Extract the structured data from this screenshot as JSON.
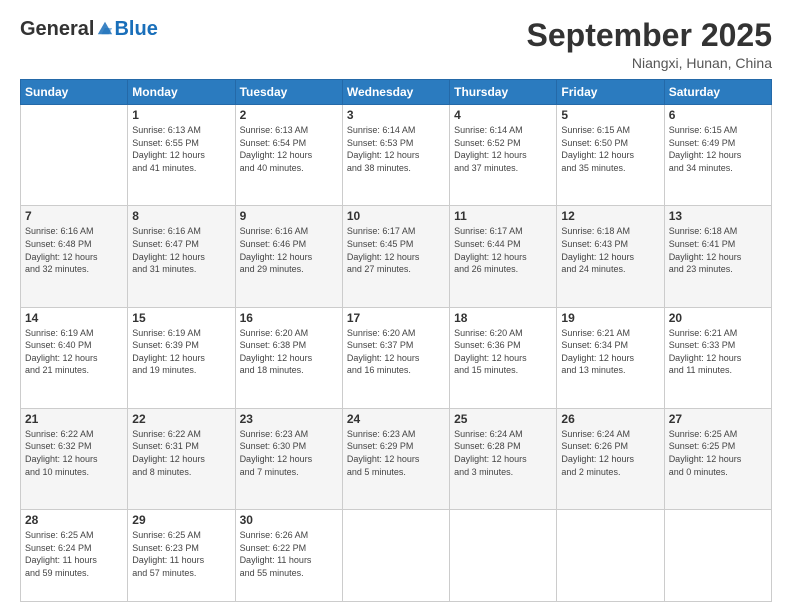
{
  "logo": {
    "general": "General",
    "blue": "Blue"
  },
  "header": {
    "month": "September 2025",
    "location": "Niangxi, Hunan, China"
  },
  "days_of_week": [
    "Sunday",
    "Monday",
    "Tuesday",
    "Wednesday",
    "Thursday",
    "Friday",
    "Saturday"
  ],
  "weeks": [
    [
      {
        "day": "",
        "info": ""
      },
      {
        "day": "1",
        "info": "Sunrise: 6:13 AM\nSunset: 6:55 PM\nDaylight: 12 hours\nand 41 minutes."
      },
      {
        "day": "2",
        "info": "Sunrise: 6:13 AM\nSunset: 6:54 PM\nDaylight: 12 hours\nand 40 minutes."
      },
      {
        "day": "3",
        "info": "Sunrise: 6:14 AM\nSunset: 6:53 PM\nDaylight: 12 hours\nand 38 minutes."
      },
      {
        "day": "4",
        "info": "Sunrise: 6:14 AM\nSunset: 6:52 PM\nDaylight: 12 hours\nand 37 minutes."
      },
      {
        "day": "5",
        "info": "Sunrise: 6:15 AM\nSunset: 6:50 PM\nDaylight: 12 hours\nand 35 minutes."
      },
      {
        "day": "6",
        "info": "Sunrise: 6:15 AM\nSunset: 6:49 PM\nDaylight: 12 hours\nand 34 minutes."
      }
    ],
    [
      {
        "day": "7",
        "info": "Sunrise: 6:16 AM\nSunset: 6:48 PM\nDaylight: 12 hours\nand 32 minutes."
      },
      {
        "day": "8",
        "info": "Sunrise: 6:16 AM\nSunset: 6:47 PM\nDaylight: 12 hours\nand 31 minutes."
      },
      {
        "day": "9",
        "info": "Sunrise: 6:16 AM\nSunset: 6:46 PM\nDaylight: 12 hours\nand 29 minutes."
      },
      {
        "day": "10",
        "info": "Sunrise: 6:17 AM\nSunset: 6:45 PM\nDaylight: 12 hours\nand 27 minutes."
      },
      {
        "day": "11",
        "info": "Sunrise: 6:17 AM\nSunset: 6:44 PM\nDaylight: 12 hours\nand 26 minutes."
      },
      {
        "day": "12",
        "info": "Sunrise: 6:18 AM\nSunset: 6:43 PM\nDaylight: 12 hours\nand 24 minutes."
      },
      {
        "day": "13",
        "info": "Sunrise: 6:18 AM\nSunset: 6:41 PM\nDaylight: 12 hours\nand 23 minutes."
      }
    ],
    [
      {
        "day": "14",
        "info": "Sunrise: 6:19 AM\nSunset: 6:40 PM\nDaylight: 12 hours\nand 21 minutes."
      },
      {
        "day": "15",
        "info": "Sunrise: 6:19 AM\nSunset: 6:39 PM\nDaylight: 12 hours\nand 19 minutes."
      },
      {
        "day": "16",
        "info": "Sunrise: 6:20 AM\nSunset: 6:38 PM\nDaylight: 12 hours\nand 18 minutes."
      },
      {
        "day": "17",
        "info": "Sunrise: 6:20 AM\nSunset: 6:37 PM\nDaylight: 12 hours\nand 16 minutes."
      },
      {
        "day": "18",
        "info": "Sunrise: 6:20 AM\nSunset: 6:36 PM\nDaylight: 12 hours\nand 15 minutes."
      },
      {
        "day": "19",
        "info": "Sunrise: 6:21 AM\nSunset: 6:34 PM\nDaylight: 12 hours\nand 13 minutes."
      },
      {
        "day": "20",
        "info": "Sunrise: 6:21 AM\nSunset: 6:33 PM\nDaylight: 12 hours\nand 11 minutes."
      }
    ],
    [
      {
        "day": "21",
        "info": "Sunrise: 6:22 AM\nSunset: 6:32 PM\nDaylight: 12 hours\nand 10 minutes."
      },
      {
        "day": "22",
        "info": "Sunrise: 6:22 AM\nSunset: 6:31 PM\nDaylight: 12 hours\nand 8 minutes."
      },
      {
        "day": "23",
        "info": "Sunrise: 6:23 AM\nSunset: 6:30 PM\nDaylight: 12 hours\nand 7 minutes."
      },
      {
        "day": "24",
        "info": "Sunrise: 6:23 AM\nSunset: 6:29 PM\nDaylight: 12 hours\nand 5 minutes."
      },
      {
        "day": "25",
        "info": "Sunrise: 6:24 AM\nSunset: 6:28 PM\nDaylight: 12 hours\nand 3 minutes."
      },
      {
        "day": "26",
        "info": "Sunrise: 6:24 AM\nSunset: 6:26 PM\nDaylight: 12 hours\nand 2 minutes."
      },
      {
        "day": "27",
        "info": "Sunrise: 6:25 AM\nSunset: 6:25 PM\nDaylight: 12 hours\nand 0 minutes."
      }
    ],
    [
      {
        "day": "28",
        "info": "Sunrise: 6:25 AM\nSunset: 6:24 PM\nDaylight: 11 hours\nand 59 minutes."
      },
      {
        "day": "29",
        "info": "Sunrise: 6:25 AM\nSunset: 6:23 PM\nDaylight: 11 hours\nand 57 minutes."
      },
      {
        "day": "30",
        "info": "Sunrise: 6:26 AM\nSunset: 6:22 PM\nDaylight: 11 hours\nand 55 minutes."
      },
      {
        "day": "",
        "info": ""
      },
      {
        "day": "",
        "info": ""
      },
      {
        "day": "",
        "info": ""
      },
      {
        "day": "",
        "info": ""
      }
    ]
  ]
}
